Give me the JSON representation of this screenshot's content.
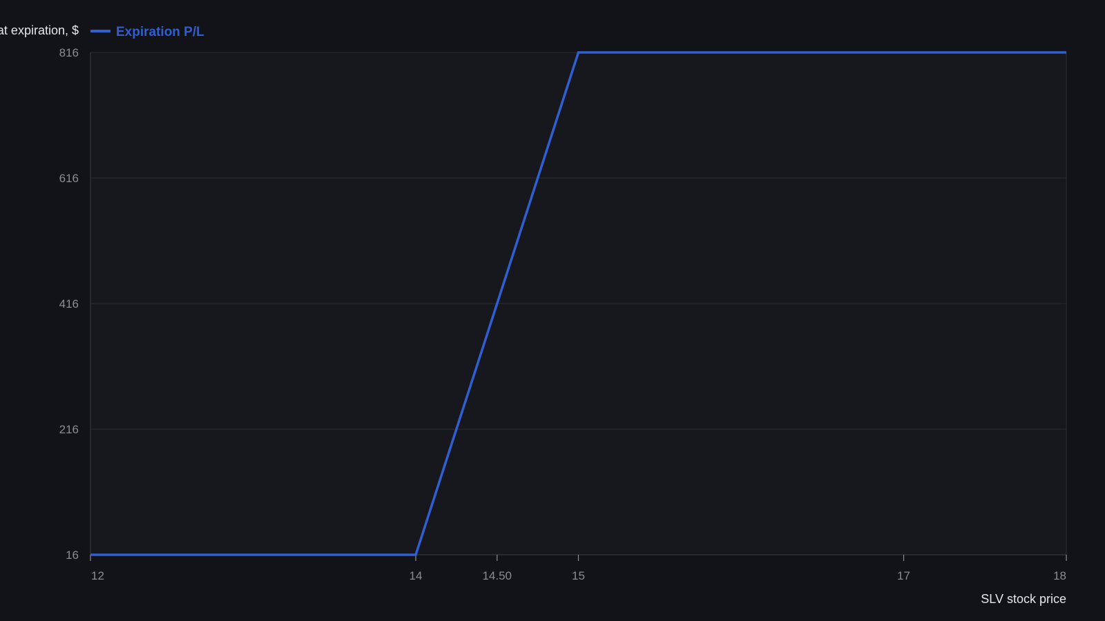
{
  "chart_data": {
    "type": "line",
    "ylabel": "Profit/loss at expiration, $",
    "xlabel": "SLV stock price",
    "x_ticks": [
      12,
      14,
      14.5,
      15,
      17,
      18
    ],
    "x_tick_labels": [
      "12",
      "14",
      "14.50",
      "15",
      "17",
      "18"
    ],
    "y_ticks": [
      16,
      216,
      416,
      616,
      816
    ],
    "y_tick_labels": [
      "16",
      "216",
      "416",
      "616",
      "816"
    ],
    "xlim": [
      12,
      18
    ],
    "ylim": [
      16,
      816
    ],
    "grid": true,
    "legend": "top-left",
    "series": [
      {
        "name": "Expiration P/L",
        "color": "#2f5fd0",
        "x": [
          12,
          14,
          15,
          18
        ],
        "y": [
          16,
          16,
          816,
          816
        ]
      }
    ]
  },
  "colors": {
    "background": "#121318",
    "plot_area": "#17181d",
    "grid": "#2a2c33",
    "series": "#2f5fd0"
  }
}
